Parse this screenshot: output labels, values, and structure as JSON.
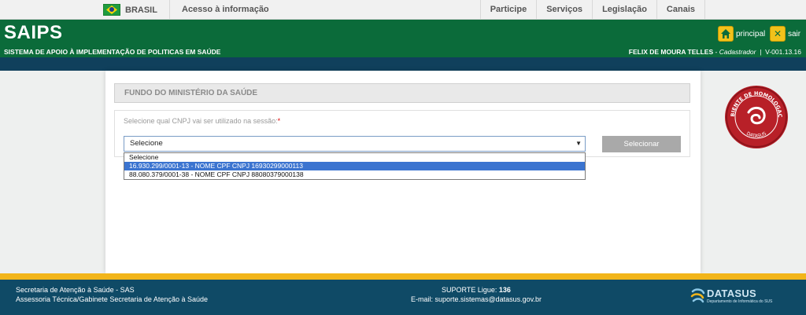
{
  "govbar": {
    "country": "BRASIL",
    "access": "Acesso à informação",
    "menu": [
      "Participe",
      "Serviços",
      "Legislação",
      "Canais"
    ]
  },
  "header": {
    "app_name": "SAIPS",
    "subtitle": "SISTEMA DE APOIO À IMPLEMENTAÇÃO DE POLITICAS EM SAÚDE",
    "home_label": "principal",
    "exit_label": "sair",
    "user_name": "FELIX DE MOURA TELLES",
    "user_role": "Cadastrador",
    "version": "V-001.13.16"
  },
  "form": {
    "section_title": "FUNDO DO MINISTÉRIO DA SAÚDE",
    "cnpj_label": "Selecione qual CNPJ vai ser utilizado na sessão:",
    "required_mark": "*",
    "select_value": "Selecione",
    "options": [
      "Selecione",
      "16.930.299/0001-13 - NOME CPF CNPJ 16930299000113",
      "88.080.379/0001-38 - NOME CPF CNPJ 88080379000138"
    ],
    "selected_index": 1,
    "submit_label": "Selecionar"
  },
  "seal": {
    "text_top": "AMBIENTE DE HOMOLOGAÇÃO",
    "text_bottom": "DATASUS"
  },
  "footer": {
    "line1": "Secretaria de Atenção à Saúde - SAS",
    "line2": "Assessoria Técnica/Gabinete Secretaria de Atenção à Saúde",
    "support_prefix": "SUPORTE Ligue:",
    "support_number": "136",
    "email": "E-mail: suporte.sistemas@datasus.gov.br",
    "brand": "DATASUS",
    "brand_sub": "Departamento de Informática do SUS"
  },
  "colors": {
    "header_green": "#0b6b3a",
    "footer_blue": "#0f4a66",
    "accent_yellow": "#f2b51a",
    "seal_red": "#b82028"
  }
}
